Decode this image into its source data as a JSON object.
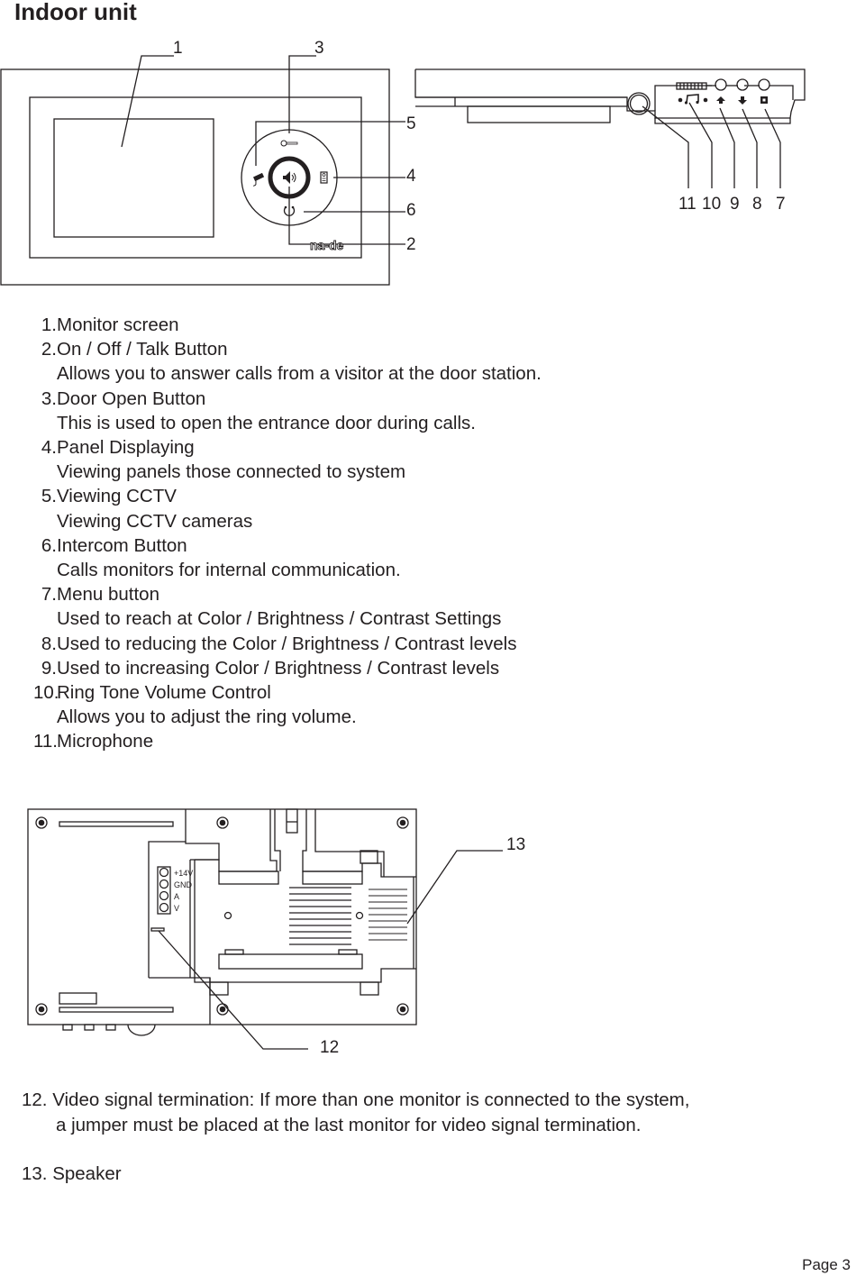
{
  "page": {
    "title": "Indoor unit",
    "page_label": "Page 3"
  },
  "front_view": {
    "brand_logo": "na-de",
    "callouts": [
      "1",
      "3",
      "5",
      "4",
      "6",
      "2"
    ],
    "icons": [
      "key-icon",
      "cctv-camera-icon",
      "speaker-icon",
      "door-panel-icon",
      "intercom-icon"
    ]
  },
  "side_view": {
    "callouts": [
      "11",
      "10",
      "9",
      "8",
      "7"
    ],
    "icons": [
      "microphone-icon",
      "music-note-icon",
      "arrow-up-icon",
      "arrow-down-icon",
      "square-menu-icon"
    ]
  },
  "legend": [
    {
      "num": "1.",
      "title": "Monitor screen",
      "desc": ""
    },
    {
      "num": "2.",
      "title": "On / Off / Talk Button",
      "desc": "Allows you to answer calls from a visitor at the door station."
    },
    {
      "num": "3.",
      "title": "Door Open Button",
      "desc": "This is used to open the entrance door during calls."
    },
    {
      "num": "4.",
      "title": "Panel Displaying",
      "desc": "Viewing panels those connected to system"
    },
    {
      "num": "5.",
      "title": "Viewing CCTV",
      "desc": "Viewing CCTV cameras"
    },
    {
      "num": "6.",
      "title": "Intercom Button",
      "desc": "Calls monitors for internal communication."
    },
    {
      "num": "7.",
      "title": "Menu button",
      "desc": "Used to reach at Color / Brightness / Contrast Settings"
    },
    {
      "num": "8.",
      "title": "Used to reducing the Color / Brightness / Contrast levels",
      "desc": ""
    },
    {
      "num": "9.",
      "title": "Used to increasing Color / Brightness / Contrast levels",
      "desc": ""
    },
    {
      "num": "10.",
      "title": "Ring Tone Volume Control",
      "desc": "Allows you to adjust the ring volume."
    },
    {
      "num": "11.",
      "title": "Microphone",
      "desc": ""
    }
  ],
  "back_view": {
    "terminals": [
      "+14V",
      "GND",
      "A",
      "V"
    ],
    "callouts": [
      "13",
      "12"
    ]
  },
  "notes": [
    {
      "line1": "12. Video signal termination: If more than one monitor is connected to the system,",
      "line2": "a jumper must be placed at the last monitor for video signal termination."
    },
    {
      "line1": "13. Speaker",
      "line2": ""
    }
  ]
}
